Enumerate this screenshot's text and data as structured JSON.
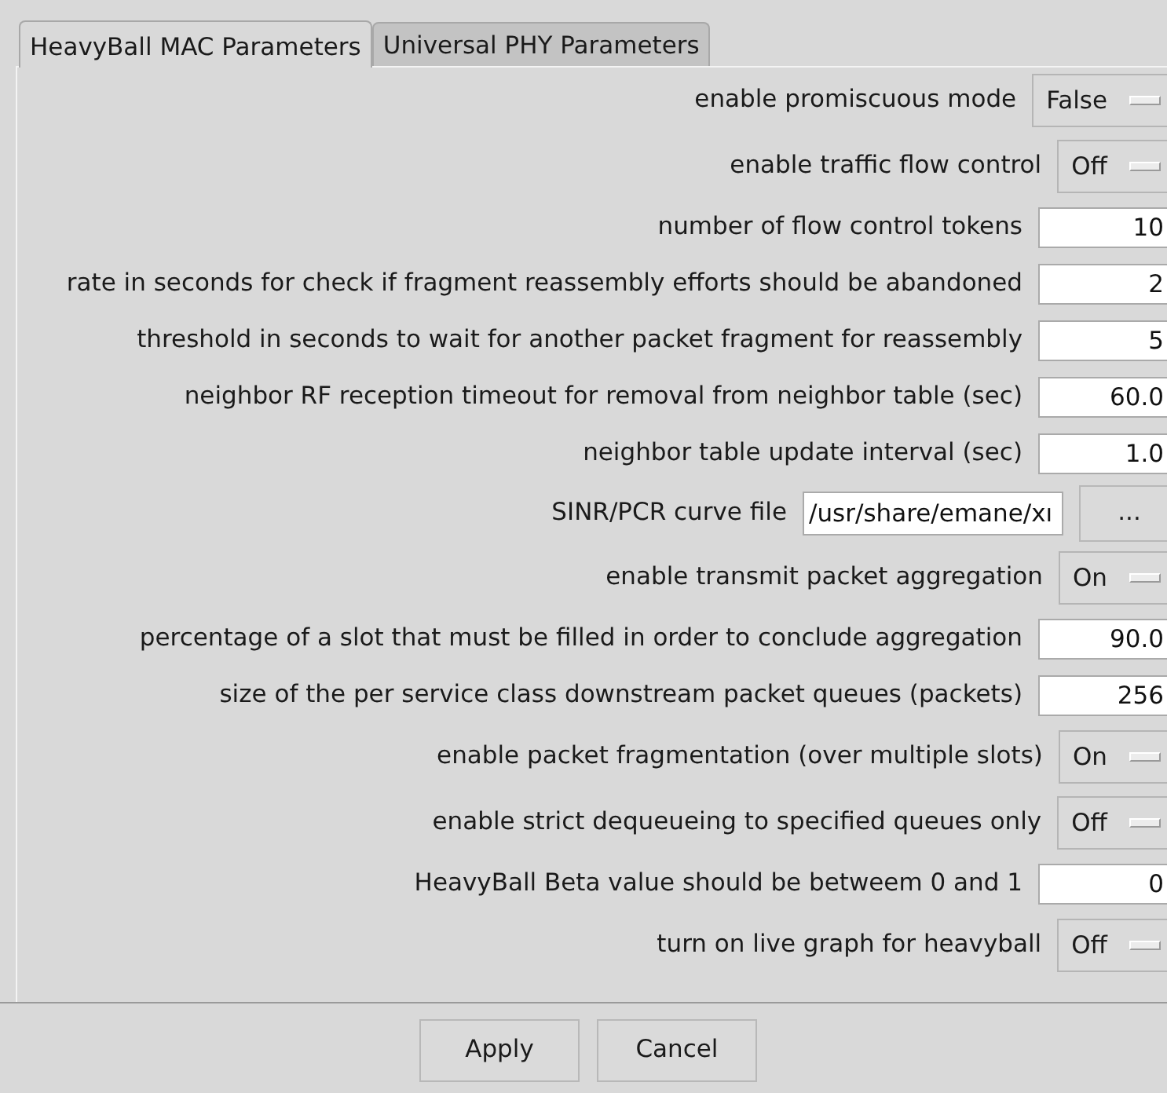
{
  "tabs": [
    {
      "label": "HeavyBall MAC Parameters",
      "selected": true
    },
    {
      "label": "Universal PHY Parameters",
      "selected": false
    }
  ],
  "parameters": [
    {
      "kind": "menu",
      "label": "enable promiscuous mode",
      "value": "False"
    },
    {
      "kind": "menu",
      "label": "enable traffic flow control",
      "value": "Off"
    },
    {
      "kind": "entry",
      "label": "number of flow control tokens",
      "value": "10"
    },
    {
      "kind": "entry",
      "label": "rate in seconds for check if fragment reassembly efforts should be abandoned",
      "value": "2"
    },
    {
      "kind": "entry",
      "label": "threshold in seconds to wait for another packet fragment for reassembly",
      "value": "5"
    },
    {
      "kind": "entry",
      "label": "neighbor RF reception timeout for removal from neighbor table (sec)",
      "value": "60.0"
    },
    {
      "kind": "entry",
      "label": "neighbor table update interval (sec)",
      "value": "1.0"
    },
    {
      "kind": "file",
      "label": "SINR/PCR curve file",
      "value": "/usr/share/emane/xı",
      "button": "..."
    },
    {
      "kind": "menu",
      "label": "enable transmit packet aggregation",
      "value": "On"
    },
    {
      "kind": "entry",
      "label": "percentage of a slot that must be filled in order to conclude aggregation",
      "value": "90.0"
    },
    {
      "kind": "entry",
      "label": "size of the per service class downstream packet queues (packets)",
      "value": "256"
    },
    {
      "kind": "menu",
      "label": "enable packet fragmentation (over multiple slots)",
      "value": "On"
    },
    {
      "kind": "menu",
      "label": "enable strict dequeueing to specified queues  only",
      "value": "Off"
    },
    {
      "kind": "entry",
      "label": "HeavyBall Beta value should be betweem 0 and 1",
      "value": "0"
    },
    {
      "kind": "menu",
      "label": "turn on live graph for heavyball",
      "value": "Off"
    }
  ],
  "buttons": [
    "Apply",
    "Cancel"
  ]
}
